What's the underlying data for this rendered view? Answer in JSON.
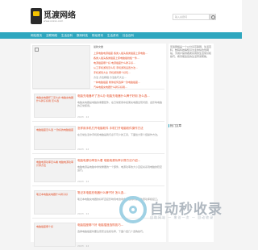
{
  "header": {
    "logo_text": "觅渡网络",
    "logo_sub": "www.xxxxx.com",
    "search_placeholder": "输入关键词"
  },
  "nav": {
    "items": [
      "网站首页",
      "互联网络",
      "生活百科",
      "数码科技",
      "财经资讯",
      "生活资讯",
      "社会百科"
    ]
  },
  "hot": {
    "title": "最新文章",
    "items": [
      "上床电脑电源插座 各类入插头各类插座上床电脑...",
      "各类入插头各类插座上床电脑插线板一件...",
      "电源插座哪个好 电源插座什么牌子好...",
      "从工手机游戏怎么玩 手机游戏设置方法...",
      "手机游戏大全 手机游戏哪个好玩...",
      "方法 方法教程 方法技巧大全...",
      "一种电脑插座 教你如何选择一款电脑插座...",
      "汽车电瓶充电器什么牌子好用..."
    ]
  },
  "articles": [
    {
      "img_title": "电脑充电器坏了怎么办 电脑充电器什么牌子好用 怎么选",
      "title": "电脑充电器坏了怎么办 电脑充电器什么牌子好用 怎么选...",
      "text": "电脑充电器是电脑的重要配件，在日常使用中如果充电器出现问题，会影响电脑的正常使用。",
      "meta": "2023 · 12"
    },
    {
      "img_title": "电脑插座怎么选 一款好的电脑插座",
      "title": "怎样用手机打开电脑软件 手机打开电脑软件操作方法",
      "text": "在日常生活中手机和电脑是我们必不可少的工具，下面给大家介绍操作方法。",
      "meta": "2023 · 12"
    },
    {
      "img_title": "电脑电源功率怎么看 电脑电源功率计算方法",
      "title": "电脑电源功率怎么看 电脑电源功率计算方法介绍...",
      "text": "电脑电源是电脑中非常重要的一个部件，电源功率的大小直接关系到电脑的稳定运行。",
      "meta": "2023 · 12"
    },
    {
      "img_title": "笔记本电脑充电器什么牌子好",
      "title": "笔记本电脑充电器什么牌子好 怎么选...",
      "text": "笔记本电脑充电器的好坏直接影响到电池寿命，选购时需要注意功率和接口。",
      "meta": "2023 · 12"
    },
    {
      "img_title": "电脑插座哪个好",
      "title": "电脑插座哪个好 电脑插座选购技巧...",
      "text": "选择电脑插座时要注意安全性和功率，下面介绍几个选购技巧。",
      "meta": "2023 · 12"
    }
  ],
  "side": {
    "text": "觅渡网络是一个以分享互联网、生活百科、数码科技等知识为主的综合性网站，为用户提供各类实用的生活常识和技巧，希望能给您的生活带来帮助。",
    "heading": "热门文章"
  },
  "watermark": {
    "text": "自动秒收录",
    "sub": "自助网站 — 来访一次 — 自动收录"
  }
}
